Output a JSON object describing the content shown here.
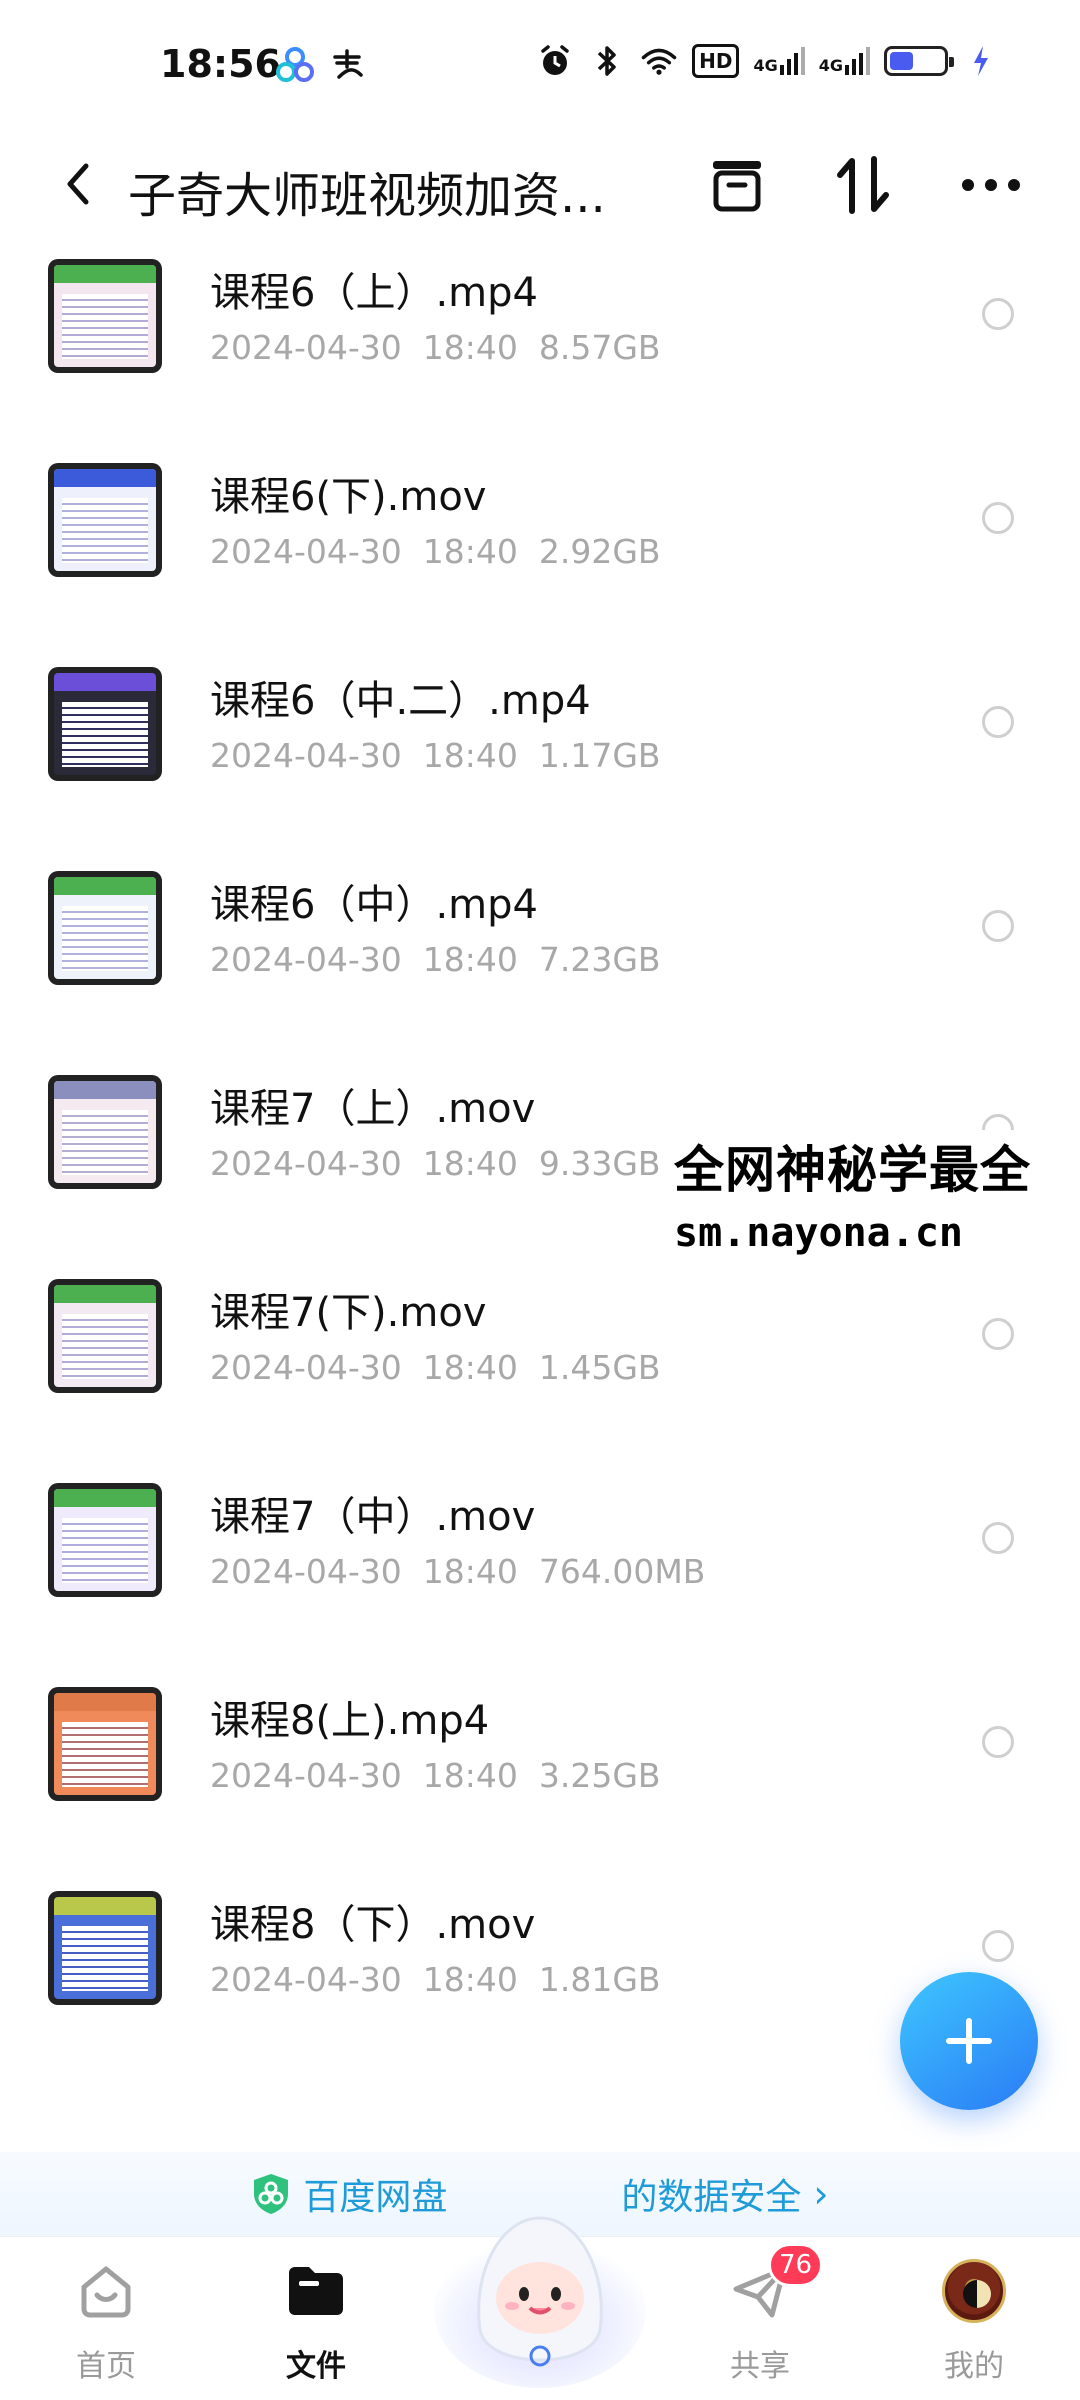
{
  "status_bar": {
    "time": "18:56",
    "hd_label": "HD",
    "net1": "4G",
    "net2": "4G",
    "battery_level_pct": 45
  },
  "header": {
    "title": "子奇大师班视频加资..."
  },
  "files": [
    {
      "name": "课程6（上）.mp4",
      "date": "2024-04-30",
      "time": "18:40",
      "size": "8.57GB",
      "thumb_accent": "#4caf50",
      "thumb_bg": "#f3e6ee"
    },
    {
      "name": "课程6(下).mov",
      "date": "2024-04-30",
      "time": "18:40",
      "size": "2.92GB",
      "thumb_accent": "#3b5bdb",
      "thumb_bg": "#eef0fb"
    },
    {
      "name": "课程6（中.二）.mp4",
      "date": "2024-04-30",
      "time": "18:40",
      "size": "1.17GB",
      "thumb_accent": "#6b4fd8",
      "thumb_bg": "#2a2a3a"
    },
    {
      "name": "课程6（中）.mp4",
      "date": "2024-04-30",
      "time": "18:40",
      "size": "7.23GB",
      "thumb_accent": "#4caf50",
      "thumb_bg": "#eef2fb"
    },
    {
      "name": "课程7（上）.mov",
      "date": "2024-04-30",
      "time": "18:40",
      "size": "9.33GB",
      "thumb_accent": "#8a8fbd",
      "thumb_bg": "#f4eaf0"
    },
    {
      "name": "课程7(下).mov",
      "date": "2024-04-30",
      "time": "18:40",
      "size": "1.45GB",
      "thumb_accent": "#4caf50",
      "thumb_bg": "#f2e9f2"
    },
    {
      "name": "课程7（中）.mov",
      "date": "2024-04-30",
      "time": "18:40",
      "size": "764.00MB",
      "thumb_accent": "#4caf50",
      "thumb_bg": "#efeafc"
    },
    {
      "name": "课程8(上).mp4",
      "date": "2024-04-30",
      "time": "18:40",
      "size": "3.25GB",
      "thumb_accent": "#e07a48",
      "thumb_bg": "#f08a5a"
    },
    {
      "name": "课程8（下）.mov",
      "date": "2024-04-30",
      "time": "18:40",
      "size": "1.81GB",
      "thumb_accent": "#b9c84a",
      "thumb_bg": "#4a6fd8"
    }
  ],
  "watermark": {
    "line1": "全网神秘学最全",
    "line2": "sm.nayona.cn"
  },
  "banner": {
    "text": "百度网盘",
    "text_tail": "的数据安全",
    "arrow": "›"
  },
  "nav": {
    "home": "首页",
    "files": "文件",
    "share": "共享",
    "share_badge": "76",
    "mine": "我的"
  },
  "colors": {
    "accent": "#2a7bf5",
    "banner_text": "#1e9bd8",
    "badge": "#ff3b57",
    "battery": "#4a5cf0"
  }
}
